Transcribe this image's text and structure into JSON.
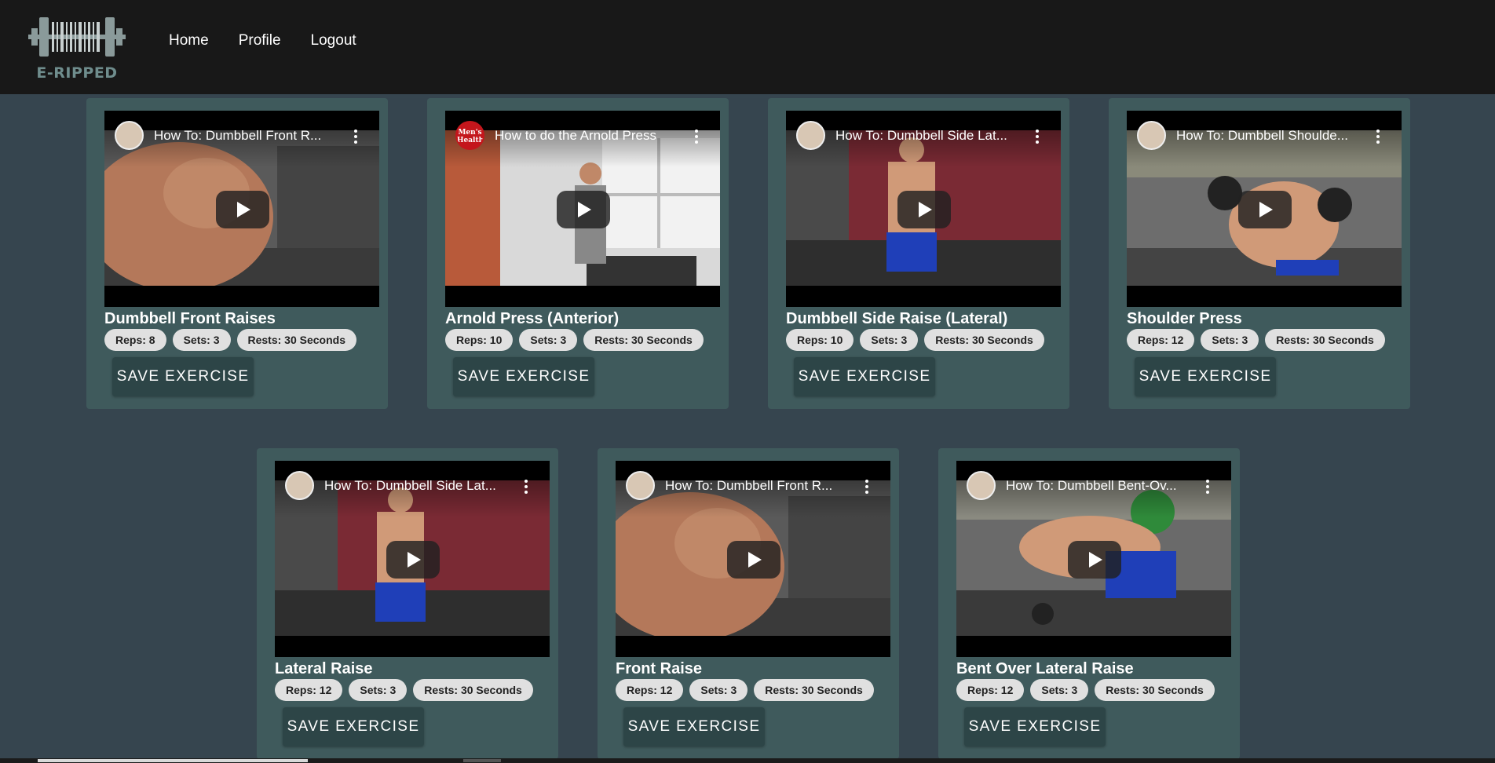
{
  "nav": {
    "logo_text": "E-RIPPED",
    "links": [
      "Home",
      "Profile",
      "Logout"
    ]
  },
  "button_label": "SAVE EXERCISE",
  "exercises": [
    {
      "name": "Dumbbell Front Raises",
      "video_title": "How To: Dumbbell Front R...",
      "reps": "Reps: 8",
      "sets": "Sets: 3",
      "rests": "Rests: 30 Seconds"
    },
    {
      "name": "Arnold Press (Anterior)",
      "video_title": "How to do the Arnold Press",
      "channel_badge": "Men's Health",
      "reps": "Reps: 10",
      "sets": "Sets: 3",
      "rests": "Rests: 30 Seconds"
    },
    {
      "name": "Dumbbell Side Raise (Lateral)",
      "video_title": "How To: Dumbbell Side Lat...",
      "reps": "Reps: 10",
      "sets": "Sets: 3",
      "rests": "Rests: 30 Seconds"
    },
    {
      "name": "Shoulder Press",
      "video_title": "How To: Dumbbell Shoulde...",
      "reps": "Reps: 12",
      "sets": "Sets: 3",
      "rests": "Rests: 30 Seconds"
    },
    {
      "name": "Lateral Raise",
      "video_title": "How To: Dumbbell Side Lat...",
      "reps": "Reps: 12",
      "sets": "Sets: 3",
      "rests": "Rests: 30 Seconds"
    },
    {
      "name": "Front Raise",
      "video_title": "How To: Dumbbell Front R...",
      "reps": "Reps: 12",
      "sets": "Sets: 3",
      "rests": "Rests: 30 Seconds"
    },
    {
      "name": "Bent Over Lateral Raise",
      "video_title": "How To: Dumbbell Bent-Ov...",
      "reps": "Reps: 12",
      "sets": "Sets: 3",
      "rests": "Rests: 30 Seconds"
    }
  ],
  "colors": {
    "navbar": "#181818",
    "page_bg": "#36454f",
    "card_bg": "#3f5a5c",
    "button_bg": "#2d4547",
    "chip_bg": "#e0e0e0"
  }
}
